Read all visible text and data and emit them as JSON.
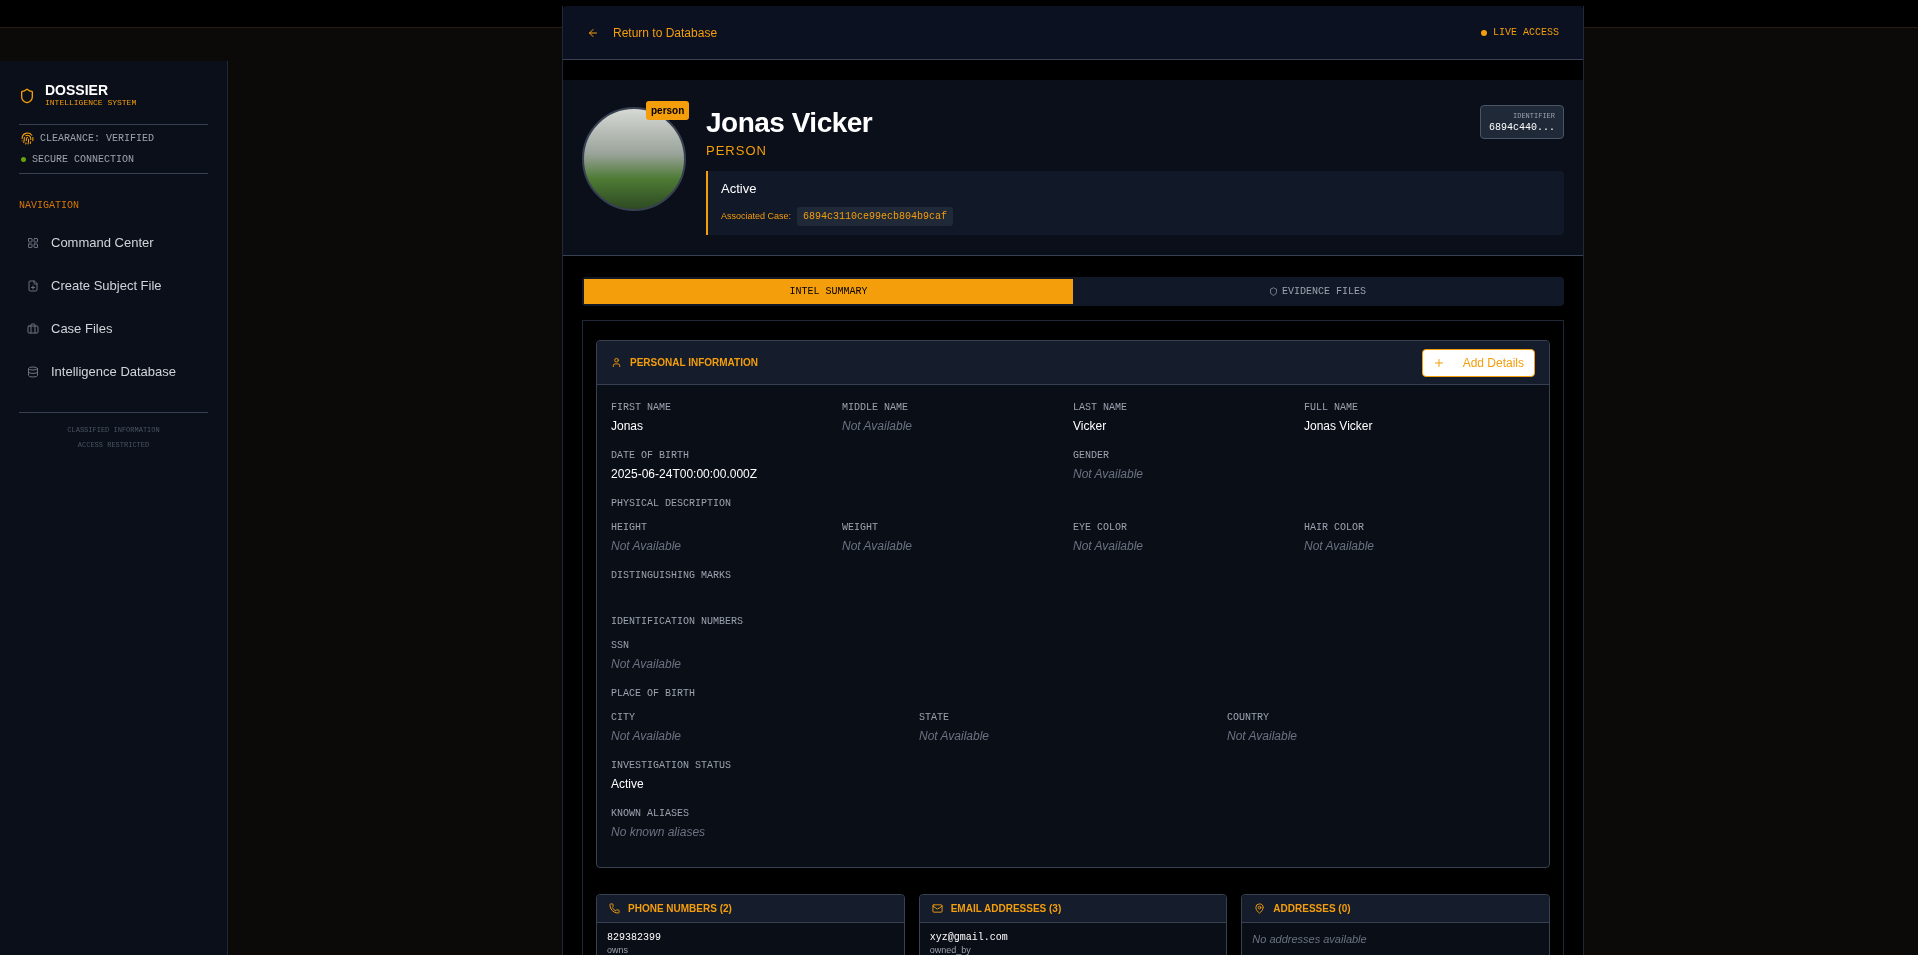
{
  "sidebar": {
    "brand": {
      "title": "DOSSIER",
      "subtitle": "INTELLIGENCE SYSTEM"
    },
    "clearance": "CLEARANCE: VERIFIED",
    "connection": "SECURE CONNECTION",
    "section_title": "NAVIGATION",
    "items": [
      {
        "label": "Command Center",
        "selected": false
      },
      {
        "label": "Create Subject File",
        "selected": false
      },
      {
        "label": "Case Files",
        "selected": false
      },
      {
        "label": "Intelligence Database",
        "selected": false
      }
    ],
    "footer": [
      "CLASSIFIED INFORMATION",
      "ACCESS RESTRICTED"
    ]
  },
  "header": {
    "back_link": "Return to Database",
    "live": "LIVE ACCESS"
  },
  "profile": {
    "badge": "person",
    "name": "Jonas Vicker",
    "type": "PERSON",
    "identifier_label": "IDENTIFIER",
    "identifier": "6894c440...",
    "status": "Active",
    "case_label": "Associated Case:",
    "case_id": "6894c3110ce99ecb804b9caf"
  },
  "tabs": [
    {
      "label": "INTEL SUMMARY",
      "selected": true
    },
    {
      "label": "EVIDENCE FILES",
      "selected": false
    }
  ],
  "personal_information": {
    "title": "PERSONAL INFORMATION",
    "button": "Add Details",
    "rows": [
      {
        "kind": "fields",
        "items": [
          {
            "label": "FIRST NAME",
            "value": "Jonas",
            "missing": false
          },
          {
            "label": "MIDDLE NAME",
            "value": "Not Available",
            "missing": true
          },
          {
            "label": "LAST NAME",
            "value": "Vicker",
            "missing": false
          },
          {
            "label": "FULL NAME",
            "value": "Jonas Vicker",
            "missing": false
          }
        ]
      },
      {
        "kind": "fields",
        "items": [
          {
            "label": "DATE OF BIRTH",
            "value": "2025-06-24T00:00:00.000Z",
            "missing": false
          },
          {
            "label": "GENDER",
            "value": "Not Available",
            "missing": true
          }
        ]
      },
      {
        "kind": "heading",
        "label": "PHYSICAL DESCRIPTION"
      },
      {
        "kind": "fields",
        "items": [
          {
            "label": "HEIGHT",
            "value": "Not Available",
            "missing": true
          },
          {
            "label": "WEIGHT",
            "value": "Not Available",
            "missing": true
          },
          {
            "label": "EYE COLOR",
            "value": "Not Available",
            "missing": true
          },
          {
            "label": "HAIR COLOR",
            "value": "Not Available",
            "missing": true
          }
        ]
      },
      {
        "kind": "fields",
        "items": [
          {
            "label": "DISTINGUISHING MARKS"
          }
        ]
      },
      {
        "kind": "heading",
        "label": "IDENTIFICATION NUMBERS"
      },
      {
        "kind": "fields",
        "items": [
          {
            "label": "SSN",
            "value": "Not Available",
            "missing": true
          }
        ]
      },
      {
        "kind": "heading",
        "label": "PLACE OF BIRTH"
      },
      {
        "kind": "fields",
        "items": [
          {
            "label": "CITY",
            "value": "Not Available",
            "missing": true
          },
          {
            "label": "STATE",
            "value": "Not Available",
            "missing": true
          },
          {
            "label": "COUNTRY",
            "value": "Not Available",
            "missing": true
          }
        ]
      },
      {
        "kind": "fields",
        "items": [
          {
            "label": "INVESTIGATION STATUS",
            "value": "Active",
            "missing": false
          }
        ]
      },
      {
        "kind": "fields",
        "items": [
          {
            "label": "KNOWN ALIASES",
            "value": "No known aliases",
            "missing": true
          }
        ]
      }
    ]
  },
  "cards": [
    {
      "title": "PHONE NUMBERS (2)",
      "entries": [
        {
          "value": "829382399",
          "relation": "owns"
        }
      ]
    },
    {
      "title": "EMAIL ADDRESSES (3)",
      "entries": [
        {
          "value": "xyz@gmail.com",
          "relation": "owned_by"
        }
      ]
    },
    {
      "title": "ADDRESSES (0)",
      "empty": "No addresses available"
    }
  ]
}
